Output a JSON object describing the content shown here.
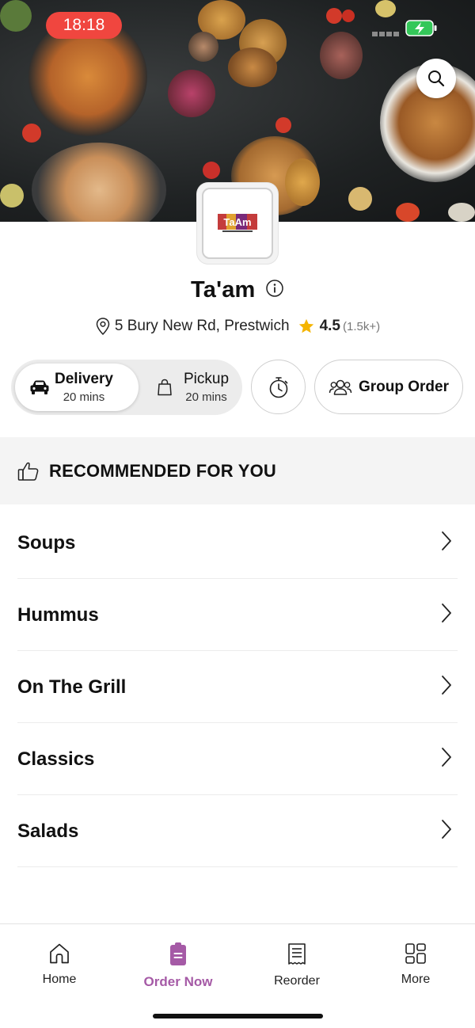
{
  "status_bar": {
    "time": "18:18"
  },
  "restaurant": {
    "logo_text": "TaAm",
    "name": "Ta'am",
    "address": "5 Bury New Rd, Prestwich",
    "rating": "4.5",
    "rating_count": "(1.5k+)"
  },
  "order_mode": {
    "delivery": {
      "label": "Delivery",
      "time": "20 mins",
      "selected": true
    },
    "pickup": {
      "label": "Pickup",
      "time": "20 mins",
      "selected": false
    }
  },
  "group_order_label": "Group Order",
  "recommended_title": "RECOMMENDED FOR YOU",
  "categories": [
    "Soups",
    "Hummus",
    "On The Grill",
    "Classics",
    "Salads"
  ],
  "tabs": [
    {
      "label": "Home",
      "icon": "home-icon",
      "active": false
    },
    {
      "label": "Order Now",
      "icon": "order-icon",
      "active": true
    },
    {
      "label": "Reorder",
      "icon": "receipt-icon",
      "active": false
    },
    {
      "label": "More",
      "icon": "grid-icon",
      "active": false
    }
  ],
  "colors": {
    "accent": "#a55aa6",
    "time_pill": "#f0463f",
    "battery": "#34c759",
    "star": "#f4b400"
  }
}
